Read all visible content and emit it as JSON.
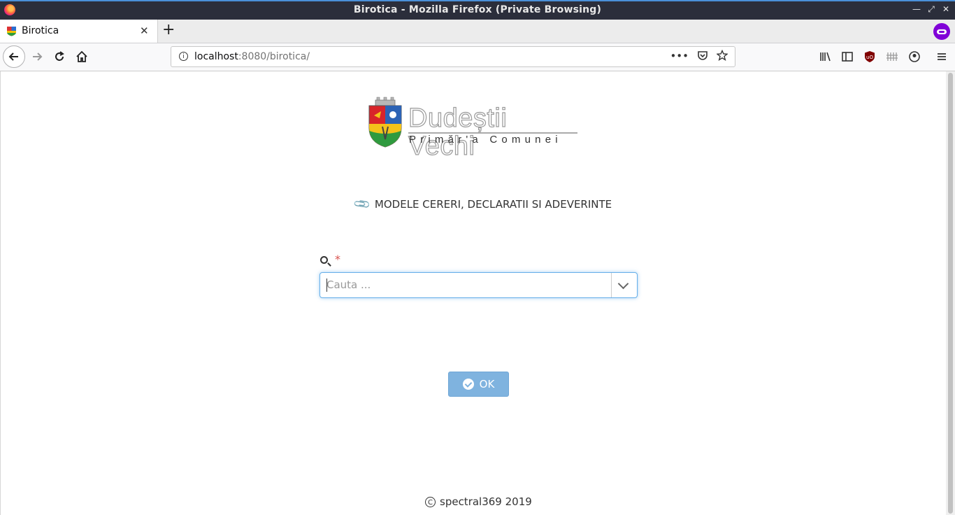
{
  "window": {
    "title": "Birotica - Mozilla Firefox (Private Browsing)",
    "controls": [
      "minimize",
      "restore",
      "close"
    ]
  },
  "tab": {
    "label": "Birotica",
    "close_glyph": "✕",
    "new_tab_glyph": "+"
  },
  "address_bar": {
    "host": "localhost",
    "path": ":8080/birotica/"
  },
  "page": {
    "logo": {
      "name": "Dudeștii Vechi",
      "subtitle": "Primăr'a Comunei"
    },
    "heading": "MODELE CERERI, DECLARATII SI ADEVERINTE",
    "search": {
      "required_mark": "*",
      "placeholder": "Cauta ..."
    },
    "ok_button": "OK",
    "footer": "spectral369 2019"
  },
  "colors": {
    "accent": "#66afe9",
    "button": "#7fb3df",
    "required": "#d9534f",
    "private_browsing": "#8000d7"
  }
}
